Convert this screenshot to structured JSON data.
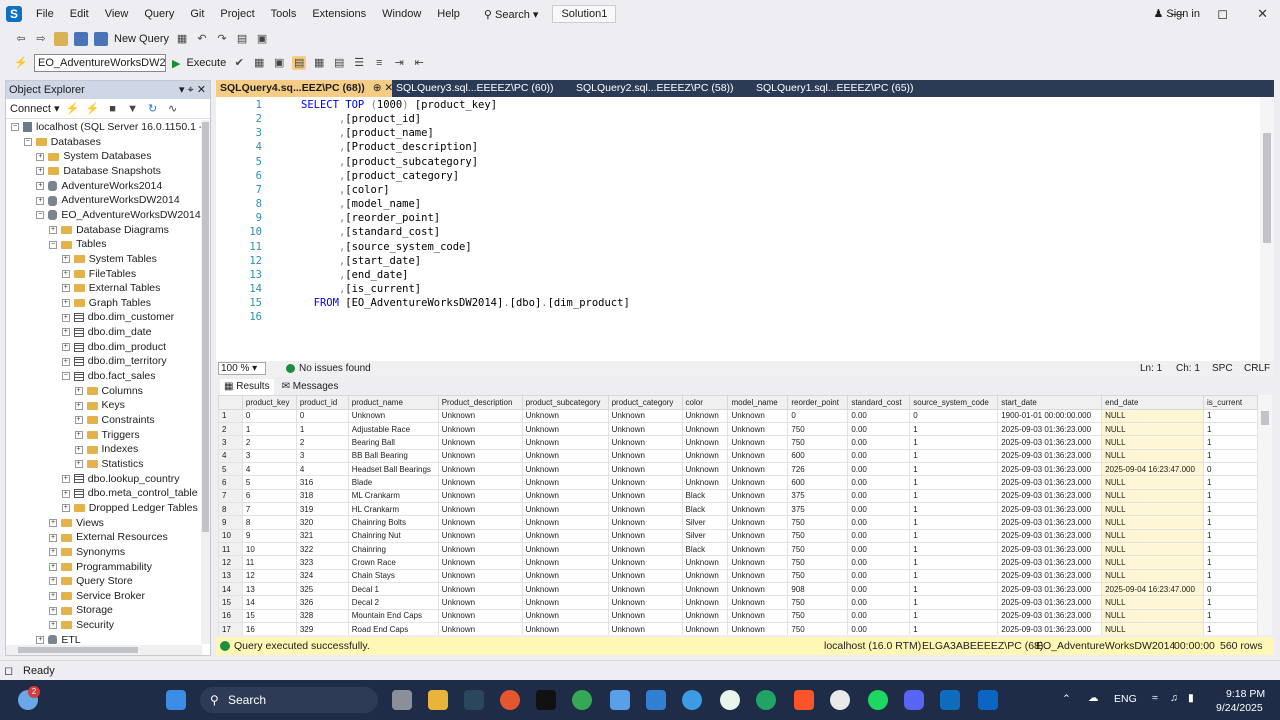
{
  "menubar": {
    "items": [
      "File",
      "Edit",
      "View",
      "Query",
      "Git",
      "Project",
      "Tools",
      "Extensions",
      "Window",
      "Help"
    ],
    "search": "Search",
    "solution": "Solution1",
    "signin": "Sign in"
  },
  "toolbar": {
    "new_query": "New Query",
    "database": "EO_AdventureWorksDW201",
    "execute": "Execute"
  },
  "object_explorer": {
    "title": "Object Explorer",
    "connect": "Connect",
    "tree": [
      {
        "level": 0,
        "exp": "−",
        "icon": "server",
        "label": "localhost (SQL Server 16.0.1150.1 - El"
      },
      {
        "level": 1,
        "exp": "−",
        "icon": "folder",
        "label": "Databases"
      },
      {
        "level": 2,
        "exp": "+",
        "icon": "folder",
        "label": "System Databases"
      },
      {
        "level": 2,
        "exp": "+",
        "icon": "folder",
        "label": "Database Snapshots"
      },
      {
        "level": 2,
        "exp": "+",
        "icon": "db",
        "label": "AdventureWorks2014"
      },
      {
        "level": 2,
        "exp": "+",
        "icon": "db",
        "label": "AdventureWorksDW2014"
      },
      {
        "level": 2,
        "exp": "−",
        "icon": "db",
        "label": "EO_AdventureWorksDW2014"
      },
      {
        "level": 3,
        "exp": "+",
        "icon": "folder",
        "label": "Database Diagrams"
      },
      {
        "level": 3,
        "exp": "−",
        "icon": "folder",
        "label": "Tables"
      },
      {
        "level": 4,
        "exp": "+",
        "icon": "folder",
        "label": "System Tables"
      },
      {
        "level": 4,
        "exp": "+",
        "icon": "folder",
        "label": "FileTables"
      },
      {
        "level": 4,
        "exp": "+",
        "icon": "folder",
        "label": "External Tables"
      },
      {
        "level": 4,
        "exp": "+",
        "icon": "folder",
        "label": "Graph Tables"
      },
      {
        "level": 4,
        "exp": "+",
        "icon": "table",
        "label": "dbo.dim_customer"
      },
      {
        "level": 4,
        "exp": "+",
        "icon": "table",
        "label": "dbo.dim_date"
      },
      {
        "level": 4,
        "exp": "+",
        "icon": "table",
        "label": "dbo.dim_product"
      },
      {
        "level": 4,
        "exp": "+",
        "icon": "table",
        "label": "dbo.dim_territory"
      },
      {
        "level": 4,
        "exp": "−",
        "icon": "table",
        "label": "dbo.fact_sales"
      },
      {
        "level": 5,
        "exp": "+",
        "icon": "folder",
        "label": "Columns"
      },
      {
        "level": 5,
        "exp": "+",
        "icon": "folder",
        "label": "Keys"
      },
      {
        "level": 5,
        "exp": "+",
        "icon": "folder",
        "label": "Constraints"
      },
      {
        "level": 5,
        "exp": "+",
        "icon": "folder",
        "label": "Triggers"
      },
      {
        "level": 5,
        "exp": "+",
        "icon": "folder",
        "label": "Indexes"
      },
      {
        "level": 5,
        "exp": "+",
        "icon": "folder",
        "label": "Statistics"
      },
      {
        "level": 4,
        "exp": "+",
        "icon": "table",
        "label": "dbo.lookup_country"
      },
      {
        "level": 4,
        "exp": "+",
        "icon": "table",
        "label": "dbo.meta_control_table"
      },
      {
        "level": 4,
        "exp": "+",
        "icon": "folder",
        "label": "Dropped Ledger Tables"
      },
      {
        "level": 3,
        "exp": "+",
        "icon": "folder",
        "label": "Views"
      },
      {
        "level": 3,
        "exp": "+",
        "icon": "folder",
        "label": "External Resources"
      },
      {
        "level": 3,
        "exp": "+",
        "icon": "folder",
        "label": "Synonyms"
      },
      {
        "level": 3,
        "exp": "+",
        "icon": "folder",
        "label": "Programmability"
      },
      {
        "level": 3,
        "exp": "+",
        "icon": "folder",
        "label": "Query Store"
      },
      {
        "level": 3,
        "exp": "+",
        "icon": "folder",
        "label": "Service Broker"
      },
      {
        "level": 3,
        "exp": "+",
        "icon": "folder",
        "label": "Storage"
      },
      {
        "level": 3,
        "exp": "+",
        "icon": "folder",
        "label": "Security"
      },
      {
        "level": 2,
        "exp": "+",
        "icon": "db",
        "label": "ETL"
      }
    ]
  },
  "tabs": [
    {
      "label": "SQLQuery4.sq...EEZ\\PC (68))",
      "active": true
    },
    {
      "label": "SQLQuery3.sql...EEEEZ\\PC (60))",
      "active": false
    },
    {
      "label": "SQLQuery2.sql...EEEEZ\\PC (58))",
      "active": false
    },
    {
      "label": "SQLQuery1.sql...EEEEZ\\PC (65))",
      "active": false
    }
  ],
  "editor": {
    "lines": [
      {
        "n": "1",
        "code": "SELECT TOP (1000) [product_key]"
      },
      {
        "n": "2",
        "code": "      ,[product_id]"
      },
      {
        "n": "3",
        "code": "      ,[product_name]"
      },
      {
        "n": "4",
        "code": "      ,[Product_description]"
      },
      {
        "n": "5",
        "code": "      ,[product_subcategory]"
      },
      {
        "n": "6",
        "code": "      ,[product_category]"
      },
      {
        "n": "7",
        "code": "      ,[color]"
      },
      {
        "n": "8",
        "code": "      ,[model_name]"
      },
      {
        "n": "9",
        "code": "      ,[reorder_point]"
      },
      {
        "n": "10",
        "code": "      ,[standard_cost]"
      },
      {
        "n": "11",
        "code": "      ,[source_system_code]"
      },
      {
        "n": "12",
        "code": "      ,[start_date]"
      },
      {
        "n": "13",
        "code": "      ,[end_date]"
      },
      {
        "n": "14",
        "code": "      ,[is_current]"
      },
      {
        "n": "15",
        "code": "  FROM [EO_AdventureWorksDW2014].[dbo].[dim_product]"
      },
      {
        "n": "16",
        "code": ""
      }
    ],
    "zoom": "100 %",
    "issues": "No issues found",
    "ln": "Ln: 1",
    "ch": "Ch: 1",
    "spc": "SPC",
    "crlf": "CRLF"
  },
  "results": {
    "tab_results": "Results",
    "tab_messages": "Messages",
    "columns": [
      "",
      "product_key",
      "product_id",
      "product_name",
      "Product_description",
      "product_subcategory",
      "product_category",
      "color",
      "model_name",
      "reorder_point",
      "standard_cost",
      "source_system_code",
      "start_date",
      "end_date",
      "is_current"
    ],
    "rows": [
      [
        "1",
        "0",
        "0",
        "Unknown",
        "Unknown",
        "Unknown",
        "Unknown",
        "Unknown",
        "Unknown",
        "0",
        "0.00",
        "0",
        "1900-01-01 00:00:00.000",
        "NULL",
        "1"
      ],
      [
        "2",
        "1",
        "1",
        "Adjustable Race",
        "Unknown",
        "Unknown",
        "Unknown",
        "Unknown",
        "Unknown",
        "750",
        "0.00",
        "1",
        "2025-09-03 01:36:23.000",
        "NULL",
        "1"
      ],
      [
        "3",
        "2",
        "2",
        "Bearing Ball",
        "Unknown",
        "Unknown",
        "Unknown",
        "Unknown",
        "Unknown",
        "750",
        "0.00",
        "1",
        "2025-09-03 01:36:23.000",
        "NULL",
        "1"
      ],
      [
        "4",
        "3",
        "3",
        "BB Ball Bearing",
        "Unknown",
        "Unknown",
        "Unknown",
        "Unknown",
        "Unknown",
        "600",
        "0.00",
        "1",
        "2025-09-03 01:36:23.000",
        "NULL",
        "1"
      ],
      [
        "5",
        "4",
        "4",
        "Headset Ball Bearings",
        "Unknown",
        "Unknown",
        "Unknown",
        "Unknown",
        "Unknown",
        "726",
        "0.00",
        "1",
        "2025-09-03 01:36:23.000",
        "2025-09-04 16:23:47.000",
        "0"
      ],
      [
        "6",
        "5",
        "316",
        "Blade",
        "Unknown",
        "Unknown",
        "Unknown",
        "Unknown",
        "Unknown",
        "600",
        "0.00",
        "1",
        "2025-09-03 01:36:23.000",
        "NULL",
        "1"
      ],
      [
        "7",
        "6",
        "318",
        "ML Crankarm",
        "Unknown",
        "Unknown",
        "Unknown",
        "Black",
        "Unknown",
        "375",
        "0.00",
        "1",
        "2025-09-03 01:36:23.000",
        "NULL",
        "1"
      ],
      [
        "8",
        "7",
        "319",
        "HL Crankarm",
        "Unknown",
        "Unknown",
        "Unknown",
        "Black",
        "Unknown",
        "375",
        "0.00",
        "1",
        "2025-09-03 01:36:23.000",
        "NULL",
        "1"
      ],
      [
        "9",
        "8",
        "320",
        "Chainring Bolts",
        "Unknown",
        "Unknown",
        "Unknown",
        "Silver",
        "Unknown",
        "750",
        "0.00",
        "1",
        "2025-09-03 01:36:23.000",
        "NULL",
        "1"
      ],
      [
        "10",
        "9",
        "321",
        "Chainring Nut",
        "Unknown",
        "Unknown",
        "Unknown",
        "Silver",
        "Unknown",
        "750",
        "0.00",
        "1",
        "2025-09-03 01:36:23.000",
        "NULL",
        "1"
      ],
      [
        "11",
        "10",
        "322",
        "Chainring",
        "Unknown",
        "Unknown",
        "Unknown",
        "Black",
        "Unknown",
        "750",
        "0.00",
        "1",
        "2025-09-03 01:36:23.000",
        "NULL",
        "1"
      ],
      [
        "12",
        "11",
        "323",
        "Crown Race",
        "Unknown",
        "Unknown",
        "Unknown",
        "Unknown",
        "Unknown",
        "750",
        "0.00",
        "1",
        "2025-09-03 01:36:23.000",
        "NULL",
        "1"
      ],
      [
        "13",
        "12",
        "324",
        "Chain Stays",
        "Unknown",
        "Unknown",
        "Unknown",
        "Unknown",
        "Unknown",
        "750",
        "0.00",
        "1",
        "2025-09-03 01:36:23.000",
        "NULL",
        "1"
      ],
      [
        "14",
        "13",
        "325",
        "Decal 1",
        "Unknown",
        "Unknown",
        "Unknown",
        "Unknown",
        "Unknown",
        "908",
        "0.00",
        "1",
        "2025-09-03 01:36:23.000",
        "2025-09-04 16:23:47.000",
        "0"
      ],
      [
        "15",
        "14",
        "326",
        "Decal 2",
        "Unknown",
        "Unknown",
        "Unknown",
        "Unknown",
        "Unknown",
        "750",
        "0.00",
        "1",
        "2025-09-03 01:36:23.000",
        "NULL",
        "1"
      ],
      [
        "16",
        "15",
        "328",
        "Mountain End Caps",
        "Unknown",
        "Unknown",
        "Unknown",
        "Unknown",
        "Unknown",
        "750",
        "0.00",
        "1",
        "2025-09-03 01:36:23.000",
        "NULL",
        "1"
      ],
      [
        "17",
        "16",
        "329",
        "Road End Caps",
        "Unknown",
        "Unknown",
        "Unknown",
        "Unknown",
        "Unknown",
        "750",
        "0.00",
        "1",
        "2025-09-03 01:36:23.000",
        "NULL",
        "1"
      ]
    ]
  },
  "query_status": {
    "message": "Query executed successfully.",
    "server": "localhost (16.0 RTM)",
    "user": "ELGA3ABEEEEZ\\PC (68)",
    "database": "EO_AdventureWorksDW2014",
    "time": "00:00:00",
    "rows": "560 rows"
  },
  "app_status": {
    "ready": "Ready"
  },
  "taskbar": {
    "search": "Search",
    "badge": "2",
    "lang": "ENG",
    "time": "9:18 PM",
    "date": "9/24/2025"
  },
  "colors": {
    "active_tab": "#f5cc84",
    "tab_strip": "#2b3a55",
    "keyword": "#0000ff",
    "line_number": "#2b91af",
    "query_status": "#fff7b5",
    "null_cell": "#fff6d5",
    "taskbar": "#1f2c47"
  }
}
